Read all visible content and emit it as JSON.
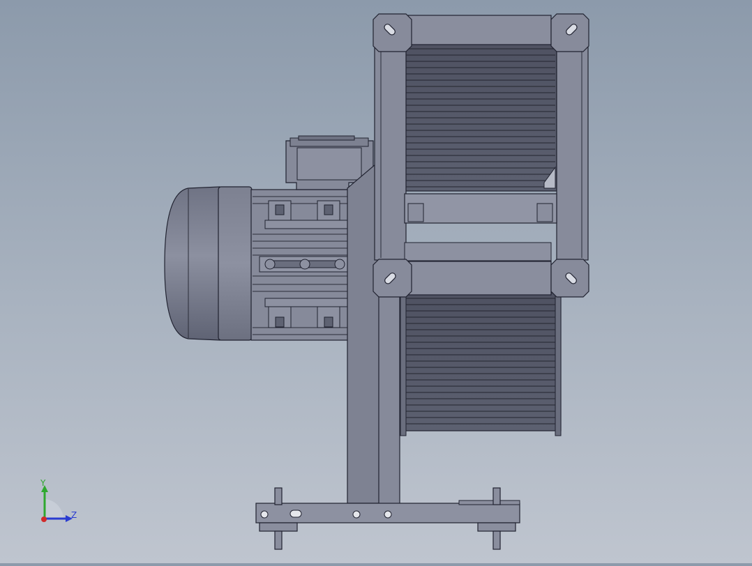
{
  "view": {
    "background_top": "#8c9aab",
    "background_bottom": "#bfc5cf",
    "part_color": "#8a8f9e"
  },
  "triad": {
    "y_label": "Y",
    "z_label": "Z",
    "y_color": "#2fa82f",
    "z_color": "#2a3cd1",
    "x_color": "#d12a2a"
  }
}
